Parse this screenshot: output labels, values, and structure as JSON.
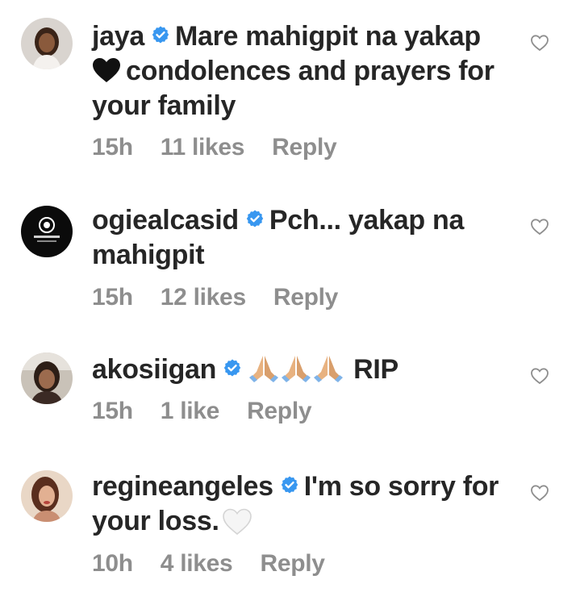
{
  "comments": [
    {
      "username": "jaya",
      "verified": true,
      "text_before": "Mare mahigpit na yakap",
      "text_after": "condolences and prayers for your family",
      "time": "15h",
      "likes": "11 likes",
      "reply": "Reply"
    },
    {
      "username": "ogiealcasid",
      "verified": true,
      "text": "Pch... yakap na mahigpit",
      "time": "15h",
      "likes": "12 likes",
      "reply": "Reply"
    },
    {
      "username": "akosiigan",
      "verified": true,
      "text": "RIP",
      "time": "15h",
      "likes": "1 like",
      "reply": "Reply"
    },
    {
      "username": "regineangeles",
      "verified": true,
      "text": "I'm so sorry for your loss.",
      "time": "10h",
      "likes": "4 likes",
      "reply": "Reply"
    }
  ],
  "icons": {
    "verified": "verified-badge-icon",
    "like": "heart-outline-icon",
    "black_heart": "black-heart-emoji",
    "white_heart": "white-heart-emoji",
    "pray": "folded-hands-emoji"
  },
  "colors": {
    "text": "#262626",
    "muted": "#8e8e8e",
    "verified": "#3897f0"
  }
}
